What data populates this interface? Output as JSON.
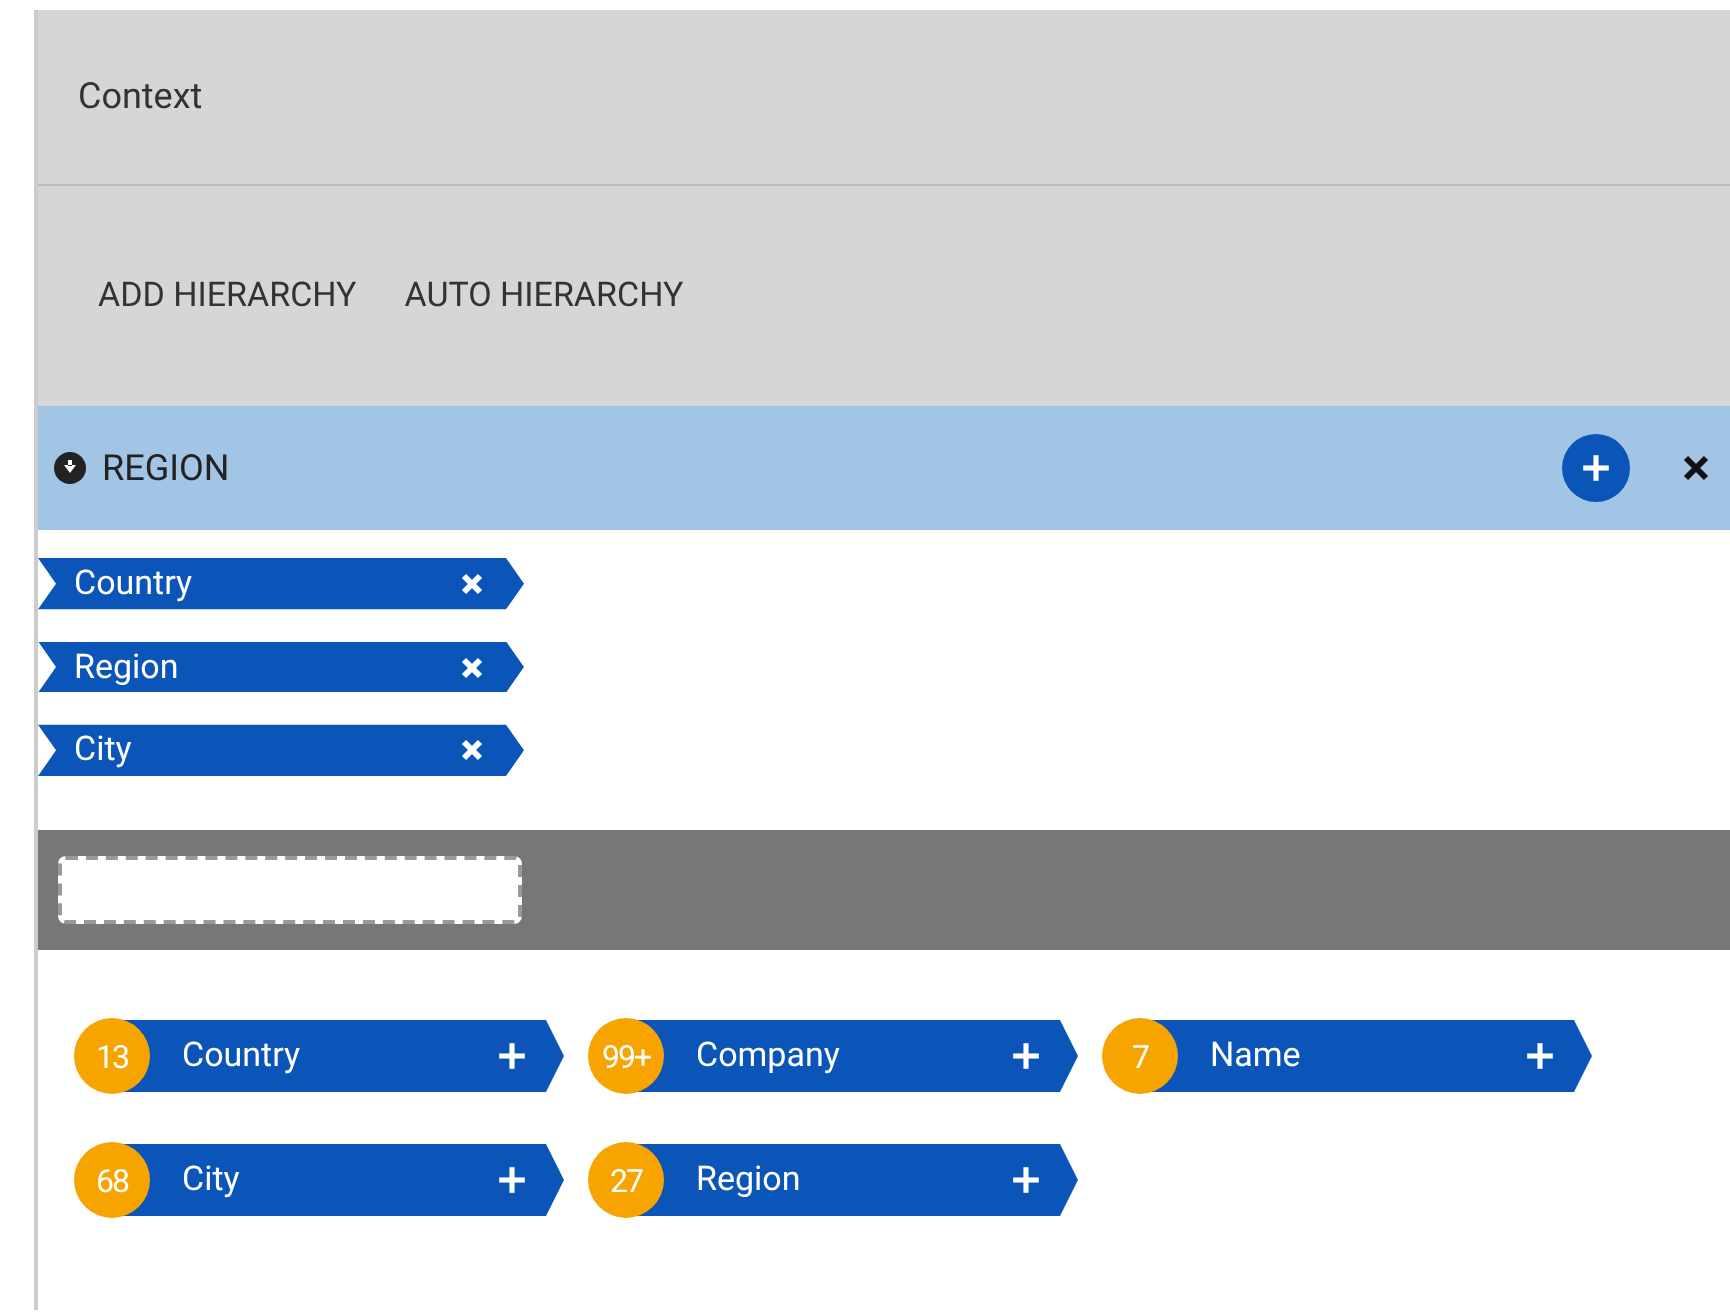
{
  "panel": {
    "title": "Context"
  },
  "toolbar": [
    "ADD HIERARCHY",
    "AUTO HIERARCHY"
  ],
  "hierarchy": {
    "name": "REGION",
    "expanded": true,
    "levels": [
      {
        "label": "Country"
      },
      {
        "label": "Region"
      },
      {
        "label": "City"
      }
    ]
  },
  "fields": [
    {
      "count": "13",
      "label": "Country"
    },
    {
      "count": "99+",
      "label": "Company"
    },
    {
      "count": "7",
      "label": "Name"
    },
    {
      "count": "68",
      "label": "City"
    },
    {
      "count": "27",
      "label": "Region"
    }
  ]
}
